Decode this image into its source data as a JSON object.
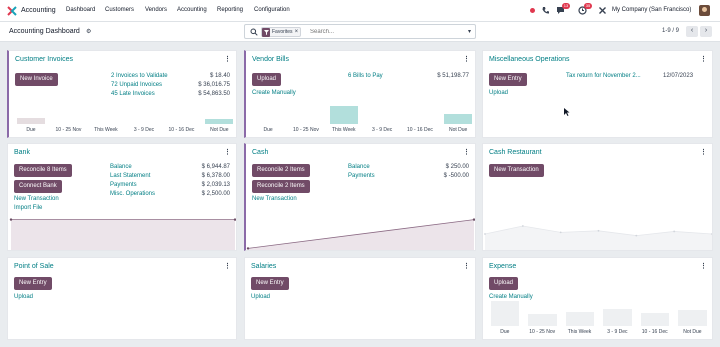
{
  "topbar": {
    "app_name": "Accounting",
    "menu": [
      "Dashboard",
      "Customers",
      "Vendors",
      "Accounting",
      "Reporting",
      "Configuration"
    ],
    "messages_badge": "13",
    "activities_badge": "35",
    "company": "My Company (San Francisco)"
  },
  "controlbar": {
    "title": "Accounting Dashboard",
    "facet_label": "Favorites",
    "search_placeholder": "Search...",
    "pager": "1-9 / 9"
  },
  "cards": {
    "customer_invoices": {
      "title": "Customer Invoices",
      "button": "New Invoice",
      "rows": [
        {
          "label": "2 Invoices to Validate",
          "amount": "$ 18.40"
        },
        {
          "label": "72 Unpaid Invoices",
          "amount": "$ 36,016.75"
        },
        {
          "label": "45 Late Invoices",
          "amount": "$ 54,863.50"
        }
      ],
      "graph": {
        "labels": [
          "Due",
          "10 - 25 Nov",
          "This Week",
          "3 - 9 Dec",
          "10 - 16 Dec",
          "Not Due"
        ],
        "values": [
          0.2,
          0,
          0,
          0,
          0,
          0.15
        ],
        "colors": [
          "#e5dde0",
          "#e5dde0",
          "#e5dde0",
          "#e5dde0",
          "#e5dde0",
          "#b2dfdc"
        ]
      }
    },
    "vendor_bills": {
      "title": "Vendor Bills",
      "button": "Upload",
      "link": "Create Manually",
      "rows": [
        {
          "label": "6 Bills to Pay",
          "amount": "$ 51,198.77"
        }
      ],
      "graph": {
        "labels": [
          "Due",
          "10 - 25 Nov",
          "This Week",
          "3 - 9 Dec",
          "10 - 16 Dec",
          "Not Due"
        ],
        "values": [
          0,
          0,
          0.55,
          0,
          0,
          0.3
        ],
        "colors": [
          "#e5dde0",
          "#e5dde0",
          "#b2dfdc",
          "#e5dde0",
          "#e5dde0",
          "#b2dfdc"
        ]
      }
    },
    "misc_operations": {
      "title": "Miscellaneous Operations",
      "button": "New Entry",
      "link": "Upload",
      "entry": {
        "label": "Tax return for November 2...",
        "date": "12/07/2023"
      }
    },
    "bank": {
      "title": "Bank",
      "buttons": [
        "Reconcile 8 Items",
        "Connect Bank"
      ],
      "links": [
        "New Transaction",
        "Import File"
      ],
      "rows": [
        {
          "label": "Balance",
          "amount": "$ 6,944.87"
        },
        {
          "label": "Last Statement",
          "amount": "$ 6,378.00"
        },
        {
          "label": "Payments",
          "amount": "$ 2,039.13"
        },
        {
          "label": "Misc. Operations",
          "amount": "$ 2,500.00"
        }
      ],
      "graph": {
        "values": [
          0.95,
          0.95
        ]
      }
    },
    "cash": {
      "title": "Cash",
      "buttons": [
        "Reconcile 2 Items",
        "Reconcile 2 Items"
      ],
      "link": "New Transaction",
      "rows": [
        {
          "label": "Balance",
          "amount": "$ 250.00"
        },
        {
          "label": "Payments",
          "amount": "$ -500.00"
        }
      ],
      "graph": {
        "values": [
          0.05,
          0.95
        ]
      }
    },
    "cash_restaurant": {
      "title": "Cash Restaurant",
      "button": "New Transaction",
      "graph": {
        "values": [
          0.5,
          0.75,
          0.55,
          0.6,
          0.45,
          0.58,
          0.5
        ]
      }
    },
    "point_of_sale": {
      "title": "Point of Sale",
      "button": "New Entry",
      "link": "Upload"
    },
    "salaries": {
      "title": "Salaries",
      "button": "New Entry",
      "link": "Upload"
    },
    "expense": {
      "title": "Expense",
      "button": "Upload",
      "link": "Create Manually",
      "graph": {
        "labels": [
          "Due",
          "10 - 25 Nov",
          "This Week",
          "3 - 9 Dec",
          "10 - 16 Dec",
          "Not Due"
        ],
        "values": [
          0.95,
          0.45,
          0.55,
          0.65,
          0.5,
          0.6
        ],
        "colors": [
          "#eef0f2",
          "#eef0f2",
          "#eef0f2",
          "#eef0f2",
          "#eef0f2",
          "#eef0f2"
        ]
      }
    }
  }
}
